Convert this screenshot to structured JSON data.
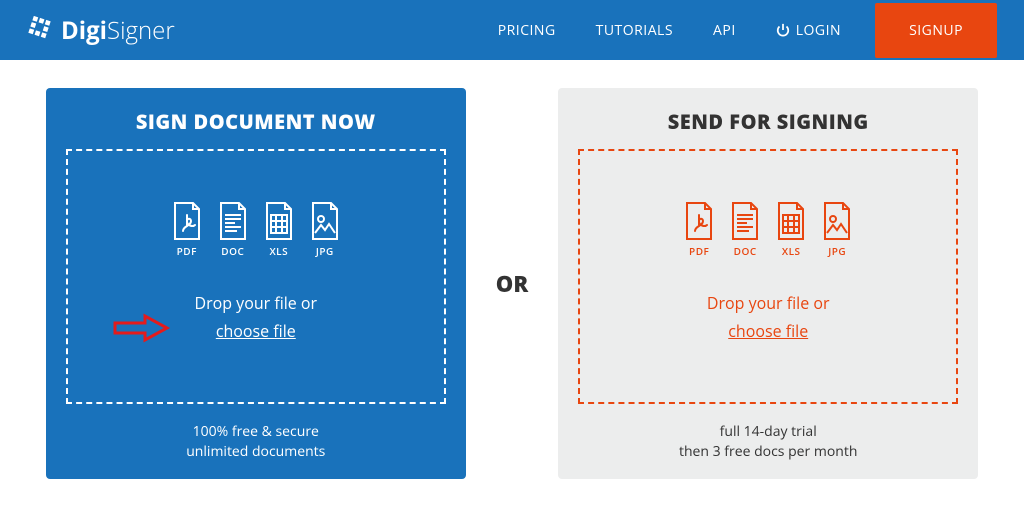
{
  "brand": {
    "name_bold": "Digi",
    "name_light": "Signer"
  },
  "nav": {
    "pricing": "PRICING",
    "tutorials": "TUTORIALS",
    "api": "API",
    "login": "LOGIN",
    "signup": "SIGNUP"
  },
  "divider": "OR",
  "sign": {
    "title": "SIGN DOCUMENT NOW",
    "drop_text": "Drop your file or",
    "choose": "choose file",
    "footer_line1": "100% free & secure",
    "footer_line2": "unlimited documents"
  },
  "send": {
    "title": "SEND FOR SIGNING",
    "drop_text": "Drop your file or",
    "choose": "choose file",
    "footer_line1": "full 14-day trial",
    "footer_line2": "then 3 free docs per month"
  },
  "file_types": {
    "pdf": "PDF",
    "doc": "DOC",
    "xls": "XLS",
    "jpg": "JPG"
  }
}
